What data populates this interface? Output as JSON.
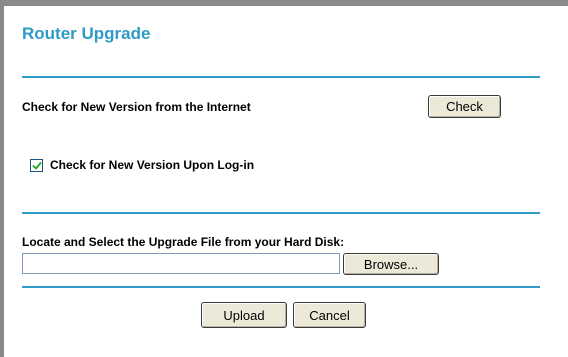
{
  "page": {
    "title": "Router Upgrade"
  },
  "check_section": {
    "label": "Check for New Version from the Internet",
    "check_button_label": "Check",
    "login_checkbox_label": "Check for New Version Upon Log-in",
    "login_checkbox_checked": true
  },
  "upgrade_section": {
    "label": "Locate and Select the Upgrade File from your Hard Disk:",
    "file_value": "",
    "browse_button_label": "Browse..."
  },
  "actions": {
    "upload_label": "Upload",
    "cancel_label": "Cancel"
  },
  "colors": {
    "accent": "#2e9bc6",
    "button_face": "#ece9d8",
    "checkbox_border": "#1c5180",
    "checkmark": "#21a121"
  },
  "icons": {
    "checkbox_mark": "checkmark-icon"
  }
}
